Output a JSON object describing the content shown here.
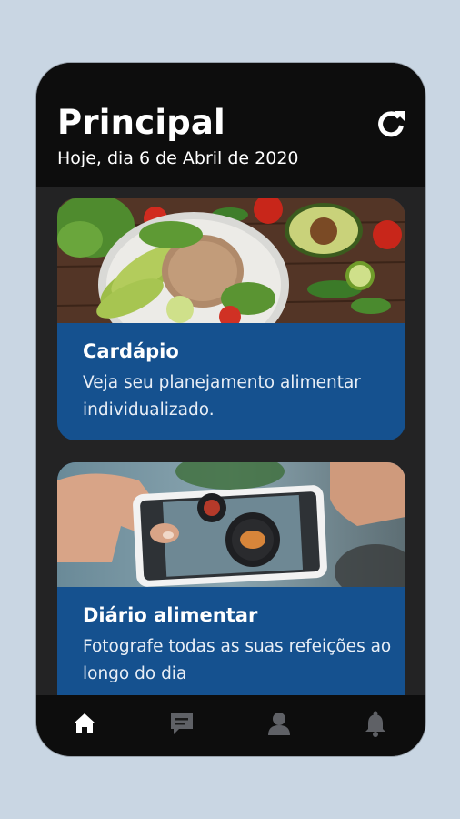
{
  "header": {
    "title": "Principal",
    "date": "Hoje, dia 6 de Abril de 2020"
  },
  "cards": [
    {
      "title": "Cardápio",
      "description": "Veja seu planejamento alimentar individualizado.",
      "image": "salad-bowl-photo"
    },
    {
      "title": "Diário alimentar",
      "description": "Fotografe todas as suas refeições ao longo do dia",
      "image": "phone-photographing-food"
    }
  ],
  "tabbar": {
    "items": [
      {
        "icon": "home-icon",
        "active": true
      },
      {
        "icon": "chat-icon",
        "active": false
      },
      {
        "icon": "user-icon",
        "active": false
      },
      {
        "icon": "bell-icon",
        "active": false
      }
    ]
  },
  "colors": {
    "background": "#c9d6e3",
    "phone": "#232324",
    "header": "#0d0d0d",
    "card": "#15518f",
    "tab_active": "#ffffff",
    "tab_inactive": "#5f6166"
  }
}
